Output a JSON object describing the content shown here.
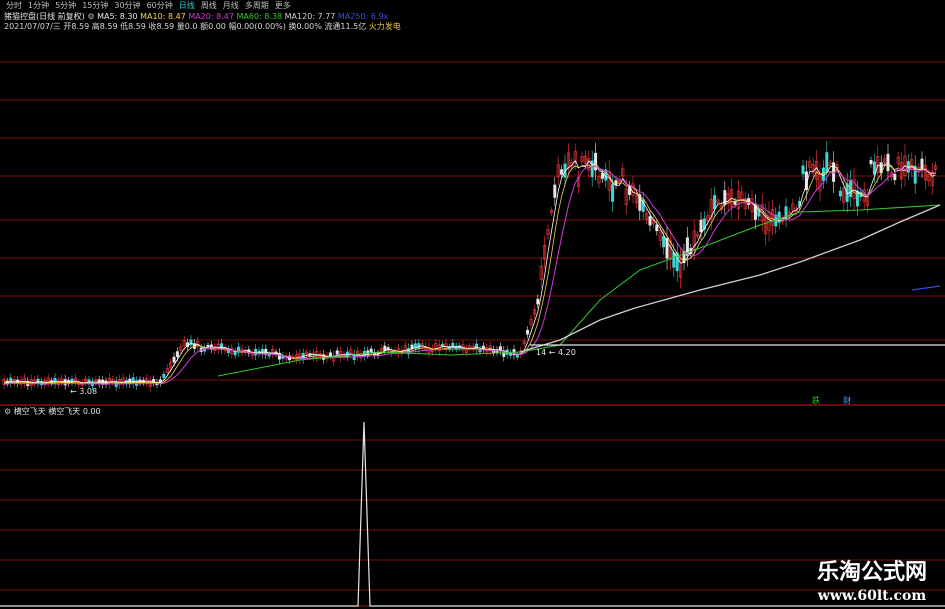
{
  "toolbar": {
    "tabs": [
      {
        "label": "分时",
        "active": false
      },
      {
        "label": "1分钟",
        "active": false
      },
      {
        "label": "5分钟",
        "active": false
      },
      {
        "label": "15分钟",
        "active": false
      },
      {
        "label": "30分钟",
        "active": false
      },
      {
        "label": "60分钟",
        "active": false
      },
      {
        "label": "日线",
        "active": true
      },
      {
        "label": "周线",
        "active": false
      },
      {
        "label": "月线",
        "active": false
      },
      {
        "label": "多周期",
        "active": false
      },
      {
        "label": "更多",
        "active": false
      }
    ]
  },
  "header": {
    "indicator_name": "猪猫控盘(日线 前复权)",
    "ma": [
      {
        "label": "MA5",
        "value": "8.30"
      },
      {
        "label": "MA10",
        "value": "8.47"
      },
      {
        "label": "MA20",
        "value": "8.47"
      },
      {
        "label": "MA60",
        "value": "8.38"
      },
      {
        "label": "MA120",
        "value": "7.77"
      },
      {
        "label": "MA250",
        "value": "6.9x"
      }
    ],
    "quote": {
      "date": "2021/07/07/三",
      "open_label": "开",
      "open": "8.59",
      "high_label": "高",
      "high": "8.59",
      "low_label": "低",
      "low": "8.59",
      "close_label": "收",
      "close": "8.59",
      "vol_label": "量",
      "vol": "0.0",
      "amt_label": "额",
      "amt": "0.00",
      "chg_label": "幅",
      "chg": "0.00(0.00%)",
      "turnover_label": "换",
      "turnover": "0.00%",
      "float_label": "流通",
      "float": "11.5亿",
      "name": "火力发电"
    }
  },
  "main_chart": {
    "price_labels": {
      "low_marker": "3.08",
      "high_marker": "4.20"
    },
    "markers": {
      "a": "跌",
      "b": "财"
    }
  },
  "indicator": {
    "title": "横空飞天",
    "line_name": "横空飞天",
    "value": "0.00"
  },
  "watermark": {
    "line1": "乐淘公式网",
    "line2": "www.60lt.com"
  },
  "colors": {
    "grid_red": "#7a0f0f",
    "up": "#ff3a3a",
    "down": "#3fd6d6",
    "ma5": "#ffffff",
    "ma10": "#f2d35a",
    "ma20": "#d23ad9",
    "ma60": "#32c832",
    "ma120": "#d0d0d0",
    "ma250": "#3f4ad8",
    "active_tab": "#27d0d0"
  }
}
